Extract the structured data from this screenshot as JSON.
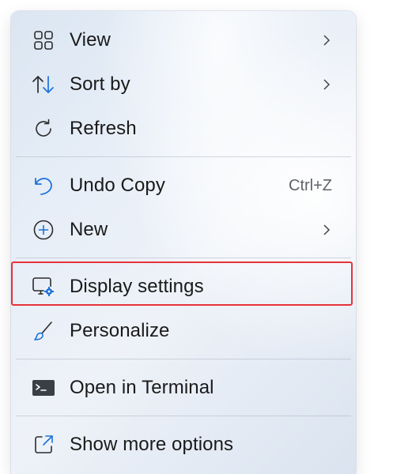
{
  "context_menu": {
    "items": [
      {
        "label": "View",
        "icon": "grid-icon",
        "has_submenu": true
      },
      {
        "label": "Sort by",
        "icon": "sort-arrows-icon",
        "has_submenu": true
      },
      {
        "label": "Refresh",
        "icon": "refresh-icon",
        "has_submenu": false
      },
      {
        "label": "Undo Copy",
        "icon": "undo-icon",
        "shortcut": "Ctrl+Z"
      },
      {
        "label": "New",
        "icon": "plus-circle-icon",
        "has_submenu": true
      },
      {
        "label": "Display settings",
        "icon": "display-settings-icon",
        "highlighted": true
      },
      {
        "label": "Personalize",
        "icon": "brush-icon"
      },
      {
        "label": "Open in Terminal",
        "icon": "terminal-icon"
      },
      {
        "label": "Show more options",
        "icon": "share-external-icon"
      }
    ]
  },
  "colors": {
    "highlight_border": "#e8323a",
    "accent_blue": "#1a73d9",
    "text": "#1a1a1a"
  }
}
